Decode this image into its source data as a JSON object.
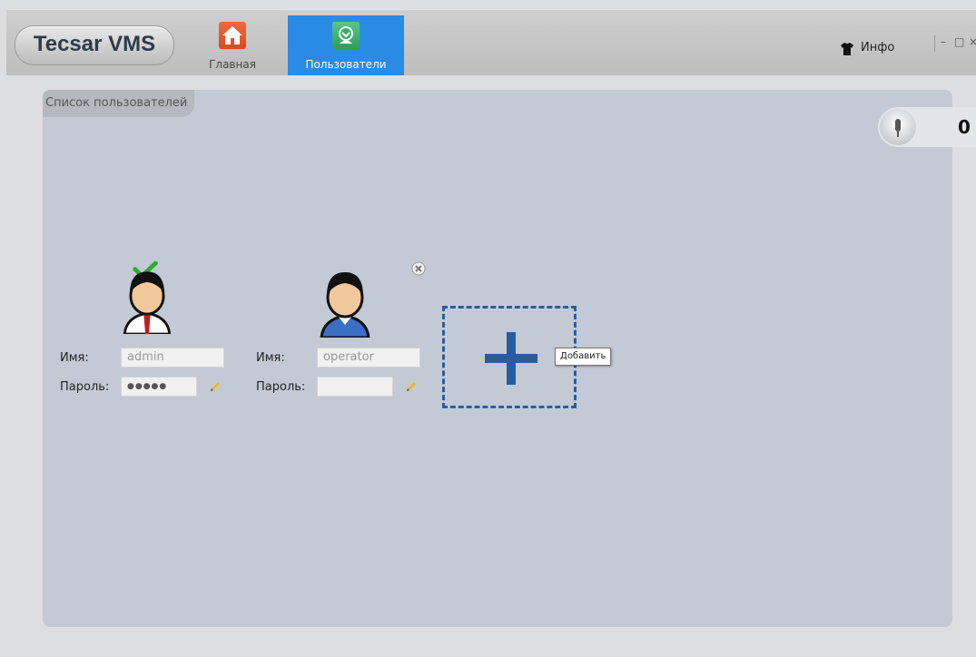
{
  "app": {
    "title": "Tecsar VMS"
  },
  "nav": {
    "items": [
      {
        "label": "Главная",
        "icon": "home-icon",
        "active": false
      },
      {
        "label": "Пользователи",
        "icon": "users-icon",
        "active": true
      }
    ]
  },
  "header": {
    "info_label": "Инфо",
    "info_icon": "shirt-icon"
  },
  "window_controls": {
    "minimize": "–",
    "maximize": "□",
    "close": "×"
  },
  "panel": {
    "tab_label": "Список пользователей"
  },
  "counter": {
    "value": "0"
  },
  "users": [
    {
      "name_label": "Имя:",
      "name_value": "admin",
      "password_label": "Пароль:",
      "password_value": "●●●●●",
      "active": true
    },
    {
      "name_label": "Имя:",
      "name_value": "operator",
      "password_label": "Пароль:",
      "password_value": "",
      "active": false
    }
  ],
  "add": {
    "tooltip": "Добавить"
  },
  "colors": {
    "accent": "#2a8be4",
    "add_border": "#275da0",
    "panel": "#c3cad5"
  }
}
